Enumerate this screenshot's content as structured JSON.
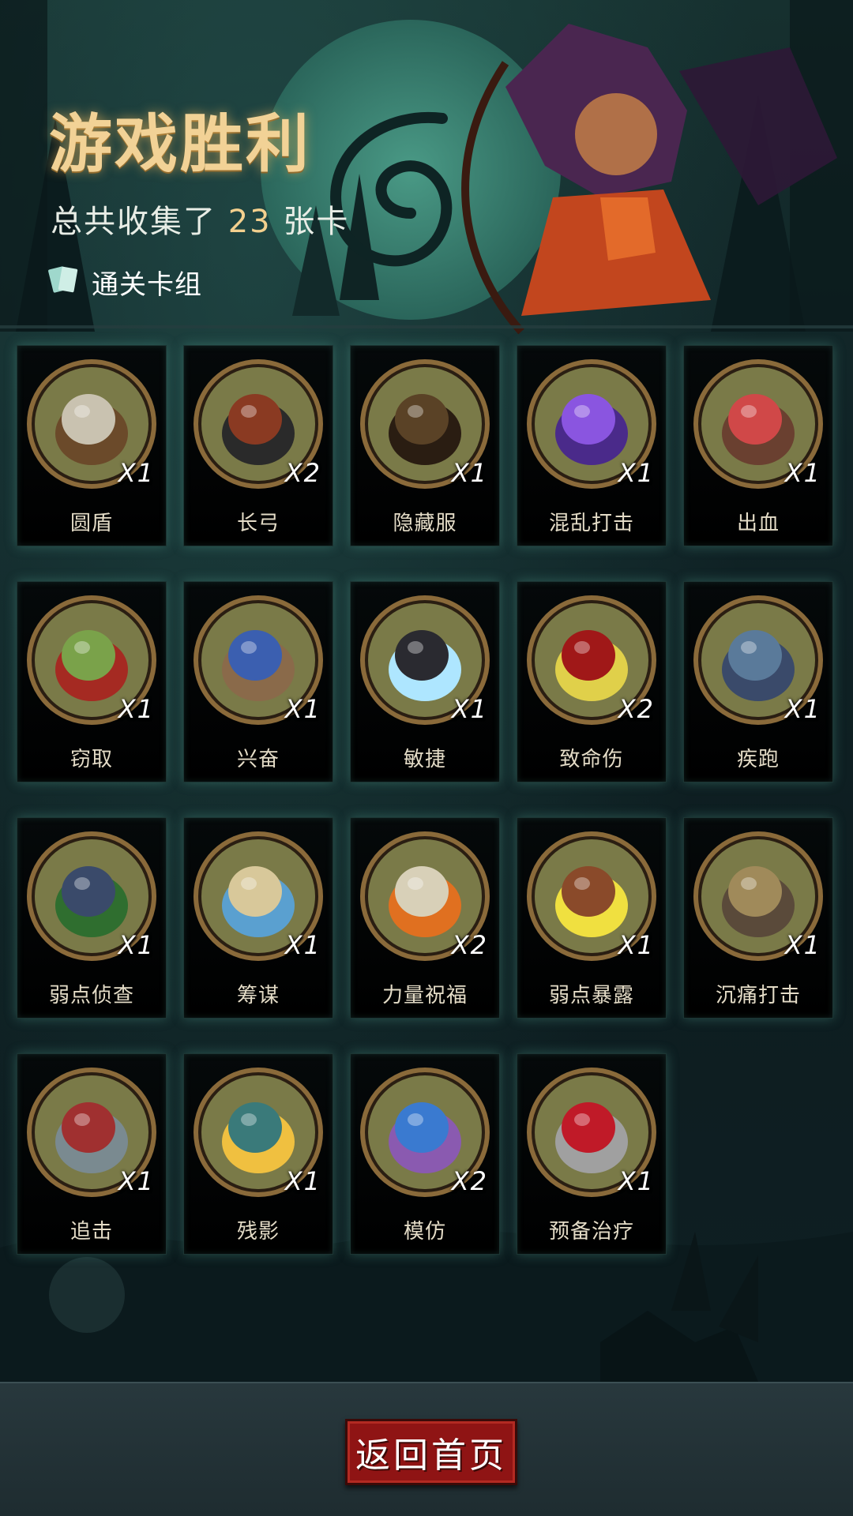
{
  "header": {
    "title": "游戏胜利",
    "summary_prefix": "总共收集了",
    "total_cards": "23",
    "summary_suffix": "张卡",
    "deck_link_label": "通关卡组"
  },
  "cards": [
    {
      "name": "圆盾",
      "qty": "X1",
      "art": "skull-shield",
      "colors": [
        "#c9c2b0",
        "#6b4a2a"
      ]
    },
    {
      "name": "长弓",
      "qty": "X2",
      "art": "longbow",
      "colors": [
        "#8a3a22",
        "#2a2a2a"
      ]
    },
    {
      "name": "隐藏服",
      "qty": "X1",
      "art": "hooded-cloak",
      "colors": [
        "#5a4226",
        "#2a1d12"
      ]
    },
    {
      "name": "混乱打击",
      "qty": "X1",
      "art": "chaos-strike",
      "colors": [
        "#8a55e0",
        "#4a2a8a"
      ]
    },
    {
      "name": "出血",
      "qty": "X1",
      "art": "bleeding-beast",
      "colors": [
        "#d04848",
        "#6a4030"
      ]
    },
    {
      "name": "窃取",
      "qty": "X1",
      "art": "goblin-thief",
      "colors": [
        "#7aa24a",
        "#a52a22"
      ]
    },
    {
      "name": "兴奋",
      "qty": "X1",
      "art": "excited-dwarf",
      "colors": [
        "#3b5fb0",
        "#8a6a4a"
      ]
    },
    {
      "name": "敏捷",
      "qty": "X1",
      "art": "black-panther",
      "colors": [
        "#2a2a30",
        "#aee6ff"
      ]
    },
    {
      "name": "致命伤",
      "qty": "X2",
      "art": "bloody-dagger",
      "colors": [
        "#a01818",
        "#e0d04a"
      ]
    },
    {
      "name": "疾跑",
      "qty": "X1",
      "art": "running-wolf",
      "colors": [
        "#5a7a9a",
        "#3a4a6a"
      ]
    },
    {
      "name": "弱点侦查",
      "qty": "X1",
      "art": "werewolf",
      "colors": [
        "#3a4a6a",
        "#2f6e2f"
      ]
    },
    {
      "name": "筹谋",
      "qty": "X1",
      "art": "battle-map",
      "colors": [
        "#d8c89a",
        "#5aa0d0"
      ]
    },
    {
      "name": "力量祝福",
      "qty": "X2",
      "art": "fist",
      "colors": [
        "#d8d0b8",
        "#e07020"
      ]
    },
    {
      "name": "弱点暴露",
      "qty": "X1",
      "art": "kicking-boot",
      "colors": [
        "#8a4a2a",
        "#f0e040"
      ]
    },
    {
      "name": "沉痛打击",
      "qty": "X1",
      "art": "ogre-smash",
      "colors": [
        "#a08a5a",
        "#5a4a3a"
      ]
    },
    {
      "name": "追击",
      "qty": "X1",
      "art": "chasing-rider",
      "colors": [
        "#a03030",
        "#7a8a90"
      ]
    },
    {
      "name": "残影",
      "qty": "X1",
      "art": "shadow-clones",
      "colors": [
        "#3a7a7a",
        "#f0c040"
      ]
    },
    {
      "name": "模仿",
      "qty": "X2",
      "art": "mimic-goblin",
      "colors": [
        "#3a7ad0",
        "#8a5ab0"
      ]
    },
    {
      "name": "预备治疗",
      "qty": "X1",
      "art": "healing-heart",
      "colors": [
        "#c01a28",
        "#a0a0a0"
      ]
    }
  ],
  "footer": {
    "home_button_label": "返回首页"
  }
}
